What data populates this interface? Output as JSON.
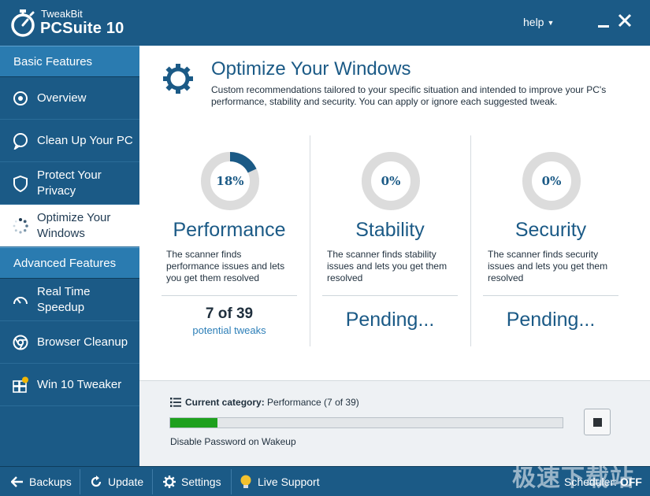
{
  "app": {
    "brand_small": "TweakBit",
    "brand_big": "PCSuite 10",
    "help_label": "help",
    "accent": "#1b5a86"
  },
  "sidebar": {
    "basic_header": "Basic Features",
    "advanced_header": "Advanced Features",
    "basic_items": [
      {
        "label": "Overview",
        "icon": "overview-icon"
      },
      {
        "label": "Clean Up Your PC",
        "icon": "cleanup-icon"
      },
      {
        "label": "Protect Your Privacy",
        "icon": "shield-icon"
      },
      {
        "label": "Optimize Your Windows",
        "icon": "spinner-icon",
        "active": true
      }
    ],
    "advanced_items": [
      {
        "label": "Real Time Speedup",
        "icon": "speedometer-icon"
      },
      {
        "label": "Browser Cleanup",
        "icon": "chrome-icon"
      },
      {
        "label": "Win 10 Tweaker",
        "icon": "windows-icon"
      }
    ]
  },
  "main": {
    "title": "Optimize Your Windows",
    "description": "Custom recommendations tailored to your specific situation and intended to improve your PC's performance, stability and security. You can apply or ignore each suggested tweak.",
    "columns": [
      {
        "percent": "18%",
        "progress": 0.18,
        "title": "Performance",
        "desc": "The scanner finds performance issues and lets you get them resolved",
        "result": "7 of 39",
        "result_sub": "potential tweaks"
      },
      {
        "percent": "0%",
        "progress": 0,
        "title": "Stability",
        "desc": "The scanner finds stability issues and lets you get them resolved",
        "pending": "Pending..."
      },
      {
        "percent": "0%",
        "progress": 0,
        "title": "Security",
        "desc": "The scanner finds security issues and lets you get them resolved",
        "pending": "Pending..."
      }
    ]
  },
  "progress": {
    "category_label": "Current category:",
    "category_value": "Performance (7 of 39)",
    "fraction": 0.12,
    "current_task": "Disable Password on Wakeup"
  },
  "bottombar": {
    "backups": "Backups",
    "update": "Update",
    "settings": "Settings",
    "live_support": "Live Support",
    "scheduler_label": "Scheduler:",
    "scheduler_state": "OFF"
  },
  "watermark": "极速下载站"
}
